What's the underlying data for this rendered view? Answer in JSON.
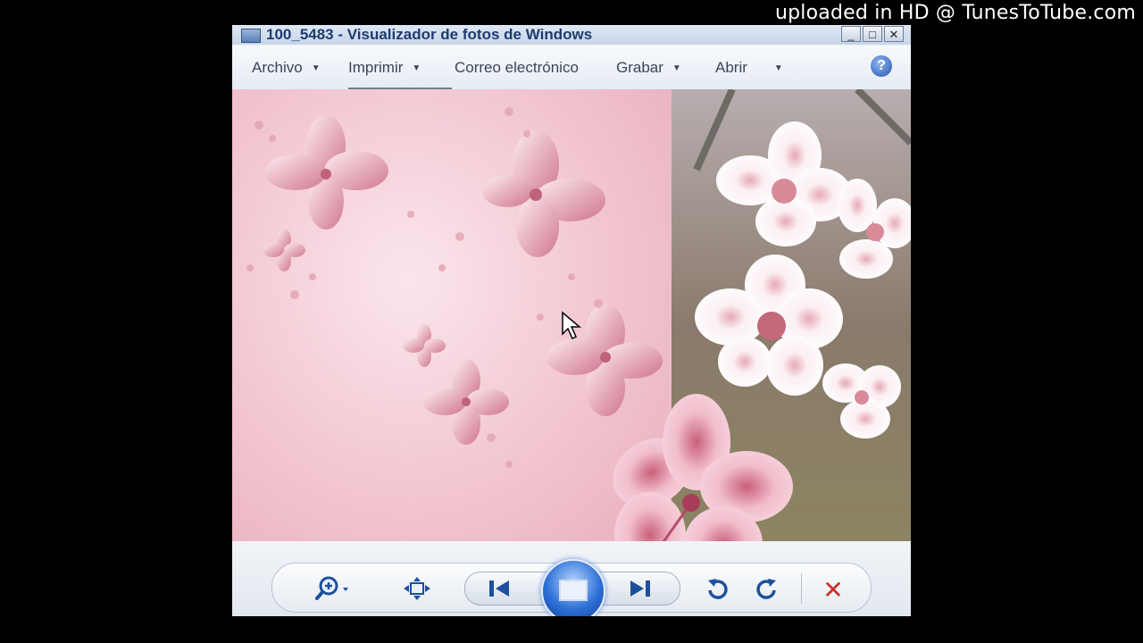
{
  "watermark": "uploaded in HD @ TunesToTube.com",
  "window": {
    "title": "100_5483 - Visualizador de fotos de Windows",
    "controls": {
      "minimize": "_",
      "maximize": "□",
      "close": "✕"
    }
  },
  "menu": {
    "items": [
      {
        "label": "Archivo",
        "has_dropdown": true
      },
      {
        "label": "Imprimir",
        "has_dropdown": true
      },
      {
        "label": "Correo electrónico",
        "has_dropdown": false
      },
      {
        "label": "Grabar",
        "has_dropdown": true
      },
      {
        "label": "Abrir",
        "has_dropdown": true
      }
    ],
    "help_label": "?"
  },
  "toolbar": {
    "zoom_icon": "magnifier-zoom-icon",
    "fit_icon": "actual-size-icon",
    "previous_icon": "previous-icon",
    "slideshow_icon": "slideshow-icon",
    "next_icon": "next-icon",
    "rotate_left_icon": "rotate-counterclockwise-icon",
    "rotate_right_icon": "rotate-clockwise-icon",
    "delete_icon": "delete-icon",
    "delete_glyph": "✕"
  },
  "colors": {
    "title_text": "#1f3b70",
    "accent_blue": "#1d4f9c",
    "delete_red": "#c8302a",
    "photo_pink": "#f0c4cf"
  }
}
